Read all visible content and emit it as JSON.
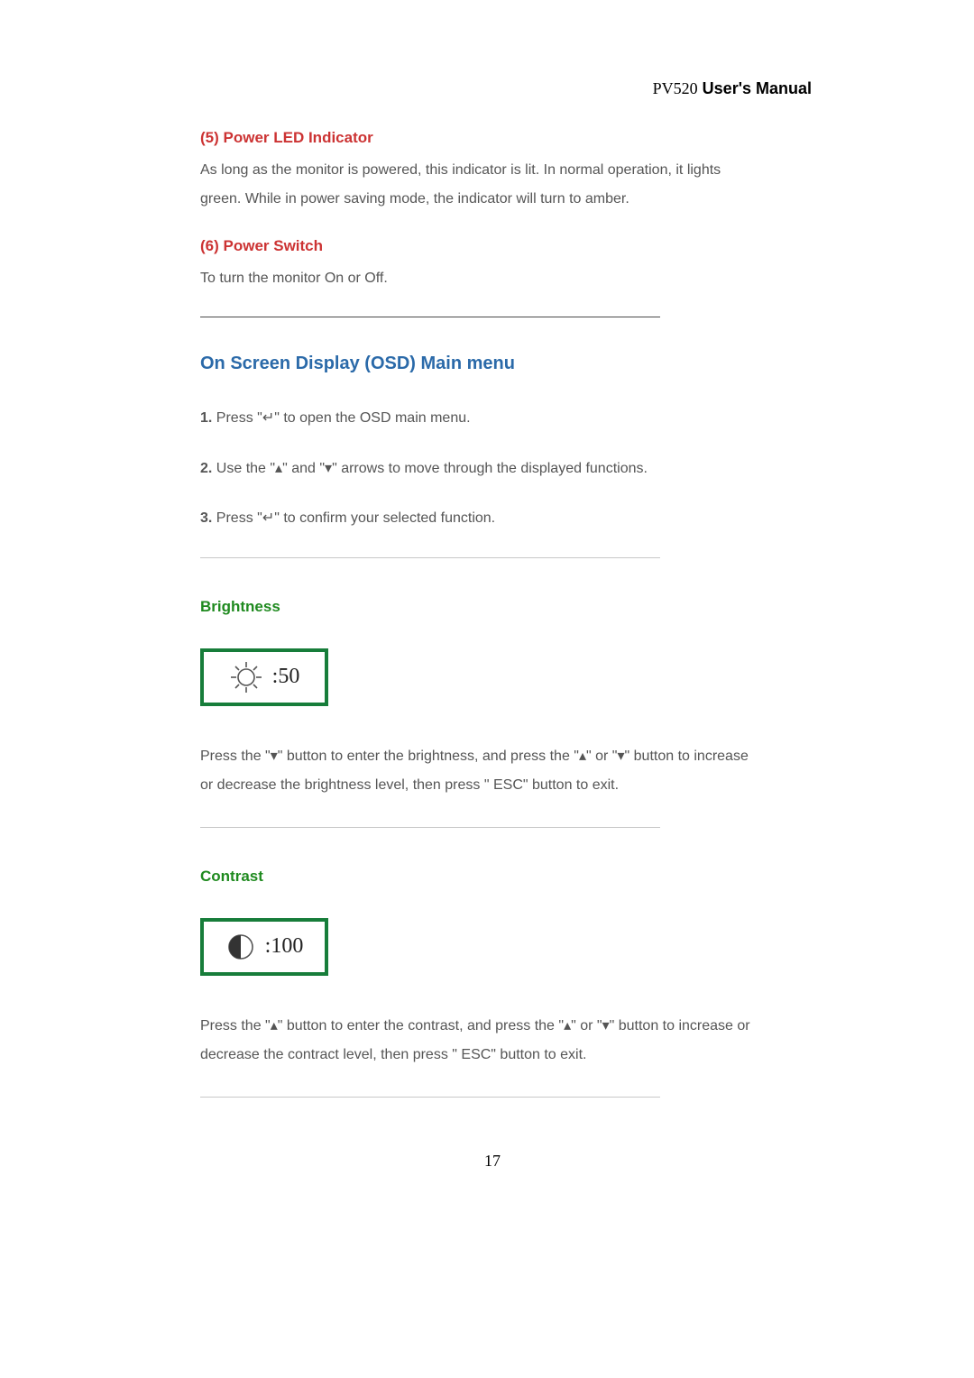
{
  "header": {
    "model": "PV520",
    "manual_label": " User's Manual"
  },
  "section5": {
    "title": "(5) Power LED Indicator",
    "body": "As long as the monitor is powered, this indicator is lit. In normal operation, it lights green. While in power saving mode, the indicator will turn to amber."
  },
  "section6": {
    "title": "(6) Power Switch",
    "body": "To turn the monitor On or Off."
  },
  "osd_heading": "On Screen Display (OSD) Main menu",
  "steps": {
    "s1_num": "1.",
    "s1_text": " Press \"↵\" to open the OSD main menu.",
    "s2_num": "2.",
    "s2_text": " Use the \"▴\" and \"▾\" arrows to move through the displayed functions.",
    "s3_num": "3.",
    "s3_text": " Press \"↵\" to confirm your selected function."
  },
  "brightness": {
    "title": "Brightness",
    "value": ":50",
    "body": "Press the \"▾\" button to enter the brightness, and press the \"▴\" or \"▾\" button to increase or decrease the brightness level, then press \" ESC\" button to exit."
  },
  "contrast": {
    "title": "Contrast",
    "value": ":100",
    "body": "Press the \"▴\" button to enter the contrast, and press the \"▴\" or \"▾\" button to increase or decrease the contract level, then press \" ESC\" button to exit."
  },
  "page_number": "17"
}
